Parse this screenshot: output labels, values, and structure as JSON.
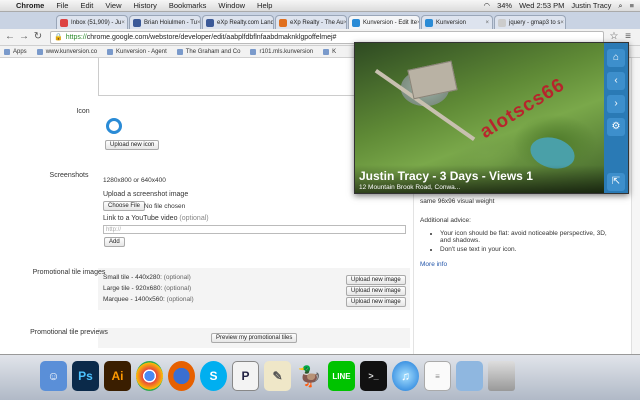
{
  "menubar": {
    "apple": "",
    "items": [
      "Chrome",
      "File",
      "Edit",
      "View",
      "History",
      "Bookmarks",
      "Window",
      "Help"
    ],
    "battery": "34%",
    "clock": "Wed 2:53 PM",
    "user": "Justin Tracy"
  },
  "tabs": [
    {
      "label": "Inbox (51,909) - Ju",
      "color": "#d44"
    },
    {
      "label": "Brian Hoiulmen - Tu",
      "color": "#3b5998"
    },
    {
      "label": "eXp Realty.com Land",
      "color": "#3b5998"
    },
    {
      "label": "eXp Realty - The Au",
      "color": "#e07020"
    },
    {
      "label": "Kunversion - Edit Ite",
      "color": "#2a8bd6",
      "active": true
    },
    {
      "label": "Kunversion",
      "color": "#2a8bd6"
    },
    {
      "label": "jquery - gmap3 to s",
      "color": "#ccc"
    }
  ],
  "toolbar": {
    "back": "←",
    "forward": "→",
    "reload": "↻",
    "url_scheme": "https://",
    "url_rest": "chrome.google.com/webstore/developer/edit/aabplfdbflnfaabdmaknklgpoffelmej#"
  },
  "bookmarks": [
    "Apps",
    "www.kunversion.co",
    "Kunversion - Agent",
    "The Graham and Co",
    "r101.mls.kunversion",
    "K"
  ],
  "form": {
    "icon_label": "Icon",
    "upload_icon": "Upload new icon",
    "screenshots_label": "Screenshots",
    "screenshot_size": "1280x800 or 640x400",
    "upload_screenshot": "Upload a screenshot image",
    "choose_file": "Choose File",
    "no_file": "No file chosen",
    "youtube_label": "Link to a YouTube video",
    "optional": "(optional)",
    "youtube_placeholder": "http://",
    "add": "Add",
    "promo_label": "Promotional tile images",
    "small_tile": "Small tile - 440x280:",
    "large_tile": "Large tile - 920x680:",
    "marquee": "Marquee - 1400x560:",
    "upload_image": "Upload new image",
    "previews_label": "Promotional tile previews",
    "preview_btn": "Preview my promotional tiles"
  },
  "sidebar_help": {
    "weight": "same 96x96 visual weight",
    "advice_title": "Additional advice:",
    "tips": [
      "Your icon should be flat: avoid noticeable perspective, 3D, and shadows.",
      "Don't use text in your icon."
    ],
    "more": "More info"
  },
  "popup": {
    "title": "Justin Tracy - 3 Days - Views 1",
    "address": "12 Mountain Brook Road, Conwa...",
    "watermark": "alotscs66",
    "buttons": [
      "home-icon",
      "chevron-left-icon",
      "chevron-right-icon",
      "gear-icon"
    ],
    "corner": "external-link-icon"
  },
  "dock": [
    "finder",
    "photoshop",
    "illustrator",
    "chrome",
    "firefox",
    "skype",
    "pandora",
    "nosy",
    "adium",
    "line",
    "terminal",
    "itunes",
    "document",
    "folder",
    "trash"
  ]
}
